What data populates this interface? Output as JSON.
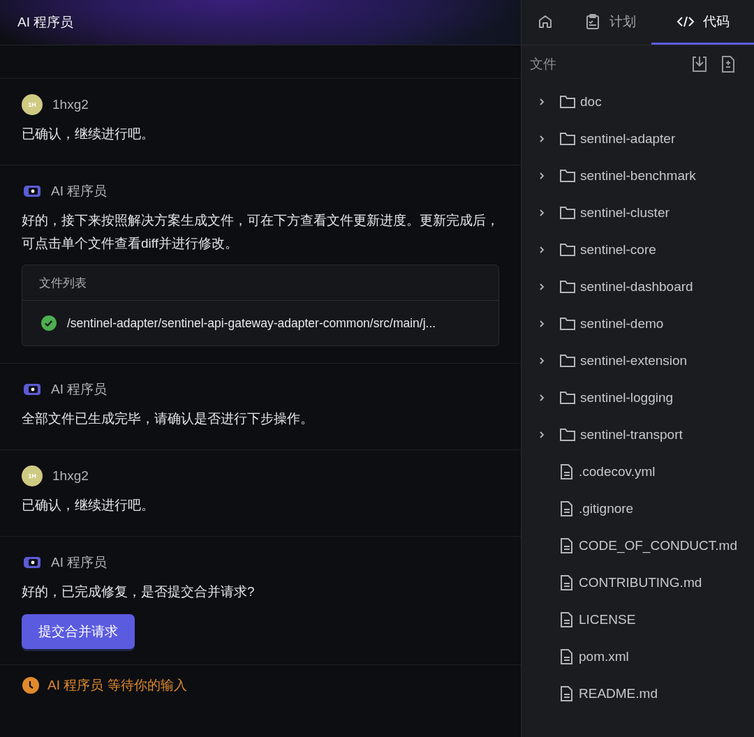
{
  "header": {
    "title": "AI 程序员"
  },
  "messages": [
    {
      "kind": "user",
      "sender": "1hxg2",
      "avatar_text": "1H",
      "text": "已确认，继续进行吧。"
    },
    {
      "kind": "ai",
      "sender": "AI 程序员",
      "text": "好的，接下来按照解决方案生成文件，可在下方查看文件更新进度。更新完成后，可点击单个文件查看diff并进行修改。",
      "file_list": {
        "title": "文件列表",
        "files": [
          {
            "path": "/sentinel-adapter/sentinel-api-gateway-adapter-common/src/main/j...",
            "done": true
          }
        ]
      }
    },
    {
      "kind": "ai",
      "sender": "AI 程序员",
      "text": "全部文件已生成完毕，请确认是否进行下步操作。"
    },
    {
      "kind": "user",
      "sender": "1hxg2",
      "avatar_text": "1H",
      "text": "已确认，继续进行吧。"
    },
    {
      "kind": "ai",
      "sender": "AI 程序员",
      "text": "好的，已完成修复，是否提交合并请求?",
      "action": "提交合并请求"
    }
  ],
  "status": "AI 程序员 等待你的输入",
  "tabs": [
    {
      "kind": "home",
      "selected": false
    },
    {
      "kind": "plan",
      "label": "计划",
      "selected": false
    },
    {
      "kind": "code",
      "label": "代码",
      "selected": true
    }
  ],
  "files_panel": {
    "title": "文件",
    "items": [
      {
        "kind": "folder",
        "name": "doc",
        "expanded": false
      },
      {
        "kind": "folder",
        "name": "sentinel-adapter",
        "expanded": false
      },
      {
        "kind": "folder",
        "name": "sentinel-benchmark",
        "expanded": false
      },
      {
        "kind": "folder",
        "name": "sentinel-cluster",
        "expanded": false
      },
      {
        "kind": "folder",
        "name": "sentinel-core",
        "expanded": false
      },
      {
        "kind": "folder",
        "name": "sentinel-dashboard",
        "expanded": false
      },
      {
        "kind": "folder",
        "name": "sentinel-demo",
        "expanded": false
      },
      {
        "kind": "folder",
        "name": "sentinel-extension",
        "expanded": false
      },
      {
        "kind": "folder",
        "name": "sentinel-logging",
        "expanded": false
      },
      {
        "kind": "folder",
        "name": "sentinel-transport",
        "expanded": false
      },
      {
        "kind": "file",
        "name": ".codecov.yml"
      },
      {
        "kind": "file",
        "name": ".gitignore"
      },
      {
        "kind": "file",
        "name": "CODE_OF_CONDUCT.md"
      },
      {
        "kind": "file",
        "name": "CONTRIBUTING.md"
      },
      {
        "kind": "file",
        "name": "LICENSE"
      },
      {
        "kind": "file",
        "name": "pom.xml"
      },
      {
        "kind": "file",
        "name": "README.md"
      }
    ]
  }
}
